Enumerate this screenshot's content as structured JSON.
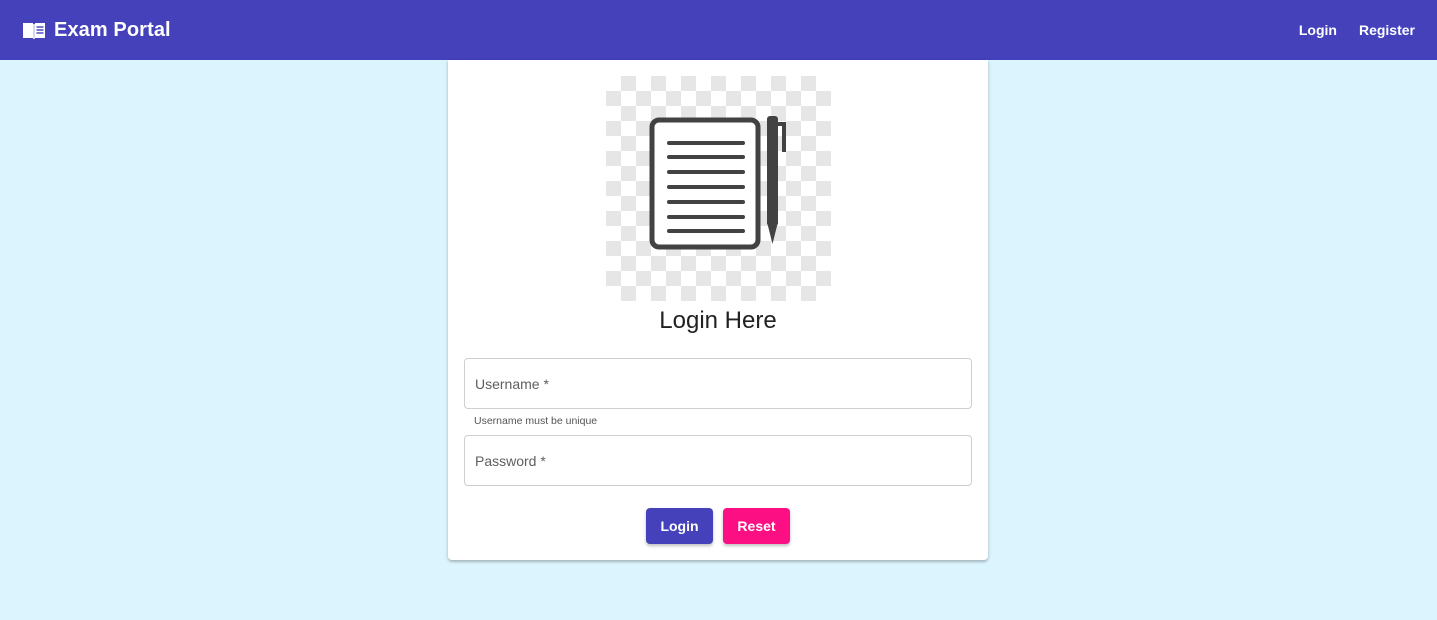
{
  "header": {
    "brand_icon": "open-book-icon",
    "title": "Exam Portal",
    "links": [
      {
        "label": "Login"
      },
      {
        "label": "Register"
      }
    ],
    "color": "#4441bb"
  },
  "login_card": {
    "logo_icon": "notepad-pen-icon",
    "title": "Login Here",
    "username": {
      "placeholder": "Username *",
      "value": "",
      "hint": "Username must be unique"
    },
    "password": {
      "placeholder": "Password *",
      "value": ""
    },
    "buttons": {
      "login_label": "Login",
      "reset_label": "Reset"
    }
  },
  "colors": {
    "background": "#dcf4fd",
    "primary": "#4441bb",
    "accent": "#fb0f83"
  }
}
